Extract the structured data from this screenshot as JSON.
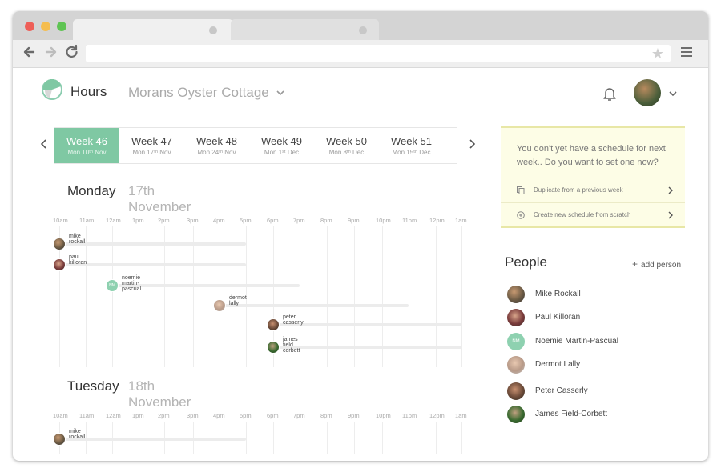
{
  "app": {
    "title": "Hours",
    "venue": "Morans Oyster Cottage"
  },
  "weeks": [
    {
      "label": "Week 46",
      "date": "Mon 10ᵗʰ Nov",
      "active": true
    },
    {
      "label": "Week 47",
      "date": "Mon 17ᵗʰ Nov",
      "active": false
    },
    {
      "label": "Week 48",
      "date": "Mon 24ᵗʰ Nov",
      "active": false
    },
    {
      "label": "Week 49",
      "date": "Mon 1ˢᵗ Dec",
      "active": false
    },
    {
      "label": "Week 50",
      "date": "Mon 8ᵗʰ Dec",
      "active": false
    },
    {
      "label": "Week 51",
      "date": "Mon 15ᵗʰ Dec",
      "active": false
    }
  ],
  "hours": [
    "10am",
    "11am",
    "12am",
    "1pm",
    "2pm",
    "3pm",
    "4pm",
    "5pm",
    "6pm",
    "7pm",
    "8pm",
    "9pm",
    "10pm",
    "11pm",
    "12pm",
    "1am"
  ],
  "days": [
    {
      "name": "Monday",
      "date": "17th November",
      "shifts": [
        {
          "name": "mike rockall",
          "start": 0,
          "end": 7,
          "avatar": "photo"
        },
        {
          "name": "paul killoran",
          "start": 0,
          "end": 7,
          "avatar": "photo"
        },
        {
          "name": "noemie martin-pascual",
          "start": 2,
          "end": 9,
          "avatar": "NM"
        },
        {
          "name": "dermot lally",
          "start": 6,
          "end": 13,
          "avatar": "photo"
        },
        {
          "name": "peter casserly",
          "start": 8,
          "end": 15,
          "avatar": "photo"
        },
        {
          "name": "james field corbett",
          "start": 8,
          "end": 15,
          "avatar": "photo"
        }
      ]
    },
    {
      "name": "Tuesday",
      "date": "18th November",
      "shifts": [
        {
          "name": "mike rockall",
          "start": 0,
          "end": 7,
          "avatar": "photo"
        }
      ]
    }
  ],
  "notice": {
    "text": "You don't yet have a schedule for next week.. Do you want to set one now?",
    "actions": [
      "Duplicate from a previous week",
      "Create new schedule from scratch"
    ]
  },
  "people": {
    "title": "People",
    "add_label": "add person",
    "list": [
      {
        "name": "Mike Rockall",
        "avatar": "photo"
      },
      {
        "name": "Paul Killoran",
        "avatar": "photo"
      },
      {
        "name": "Noemie Martin-Pascual",
        "avatar": "NM"
      },
      {
        "name": "Dermot Lally",
        "avatar": "photo"
      },
      {
        "name": "Peter Casserly",
        "avatar": "photo"
      },
      {
        "name": "James Field-Corbett",
        "avatar": "photo"
      }
    ]
  },
  "colors": {
    "accent": "#7fc8a3",
    "notice_bg": "#fdfde6"
  },
  "icons": [
    "back-icon",
    "forward-icon",
    "reload-icon",
    "star-icon",
    "menu-icon",
    "logo-icon",
    "chevron-down-icon",
    "bell-icon",
    "chevron-left-icon",
    "chevron-right-icon",
    "copy-icon",
    "plus-circle-icon",
    "plus-icon"
  ]
}
